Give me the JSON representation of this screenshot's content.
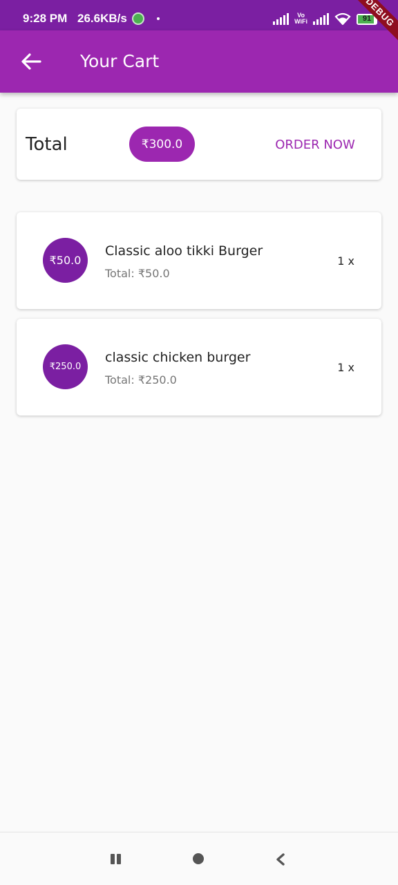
{
  "status_bar": {
    "time": "9:28 PM",
    "network_speed": "26.6KB/s",
    "vowifi_line1": "Vo",
    "vowifi_line2": "WiFi",
    "battery": "91"
  },
  "debug_banner": "DEBUG",
  "app_bar": {
    "title": "Your Cart",
    "back_icon": "arrow-back-icon"
  },
  "summary": {
    "total_label": "Total",
    "total_amount": "₹300.0",
    "order_button": "ORDER NOW"
  },
  "cart_items": [
    {
      "price": "₹50.0",
      "name": "Classic aloo tikki Burger",
      "subtotal": "Total: ₹50.0",
      "quantity": "1 x"
    },
    {
      "price": "₹250.0",
      "name": "classic chicken burger",
      "subtotal": "Total: ₹250.0",
      "quantity": "1 x"
    }
  ],
  "nav_bar": {
    "icons": [
      "recents-icon",
      "home-icon",
      "back-icon"
    ]
  },
  "colors": {
    "primary": "#9c27b0",
    "primary_dark": "#7b1fa2",
    "background": "#fafafa"
  }
}
